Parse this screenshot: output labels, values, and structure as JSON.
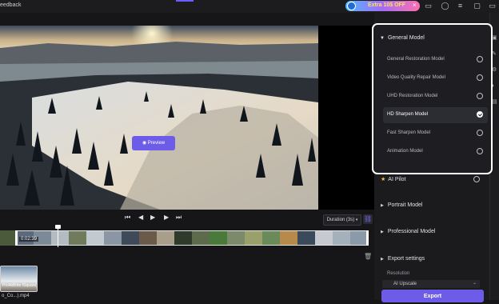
{
  "topbar": {
    "feedback_label": "eedback",
    "promo_text": "Extra 10$ OFF",
    "promo_close": "×",
    "icons": [
      "chat-icon",
      "user-icon",
      "menu-icon",
      "minimize-icon",
      "maximize-icon"
    ]
  },
  "preview": {
    "button_label": "Preview",
    "button_icon": "eye-icon",
    "colors": {
      "accent": "#6c5ce7"
    }
  },
  "controls": {
    "prev_label": "⏮",
    "step_back_label": "◀",
    "play_label": "▶",
    "step_fwd_label": "▶",
    "next_label": "⏭",
    "duration_label": "Duration (3s)"
  },
  "timeline": {
    "time_label": "0:02:39",
    "frame_colors": [
      "#5a6a7c",
      "#7b8a96",
      "#b3bcc2",
      "#6f7b5a",
      "#c2cad1",
      "#8a96a3",
      "#3e4a5a",
      "#6a5a4a",
      "#a89e8a",
      "#2e3a2a",
      "#5b6b4b",
      "#4a7a3a",
      "#7a8a6a",
      "#9aa06a",
      "#6a8a5a",
      "#b88a4a",
      "#3a4a5a",
      "#c6c9cf",
      "#a4b0ba",
      "#8a9aa8"
    ]
  },
  "media": {
    "thumb_label": "Pro4kBrite fSquare)",
    "file_name": "o_Co...).mp4"
  },
  "panel": {
    "general_model_title": "General Model",
    "options": [
      {
        "label": "General Restoration Model",
        "checked": false
      },
      {
        "label": "Video Quality Repair Model",
        "checked": false
      },
      {
        "label": "UHD Restoration Model",
        "checked": false
      },
      {
        "label": "HD Sharpen Model",
        "checked": true
      },
      {
        "label": "Fast Sharpen Model",
        "checked": false
      },
      {
        "label": "Animation Model",
        "checked": false
      }
    ],
    "ai_pilot": "AI Pilot",
    "portrait_model": "Portrait Model",
    "professional_model": "Professional Model",
    "export_settings": "Export settings",
    "resolution_label": "Resolution",
    "resolution_value": "AI Upscale",
    "export_label": "Export"
  }
}
